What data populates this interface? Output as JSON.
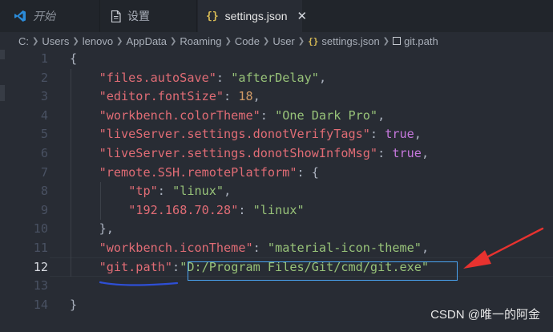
{
  "tabs": [
    {
      "label": "开始",
      "icon": "vscode-logo-icon"
    },
    {
      "label": "设置",
      "icon": "file-icon"
    },
    {
      "label": "settings.json",
      "icon": "json-braces-icon",
      "close": "✕"
    }
  ],
  "breadcrumb": {
    "parts": [
      "C:",
      "Users",
      "lenovo",
      "AppData",
      "Roaming",
      "Code",
      "User"
    ],
    "file": "settings.json",
    "symbol": "git.path"
  },
  "editor": {
    "active_line": "12",
    "line_numbers": [
      "1",
      "2",
      "3",
      "4",
      "5",
      "6",
      "7",
      "8",
      "9",
      "10",
      "11",
      "12",
      "13",
      "14"
    ],
    "lines": [
      {
        "t": "{"
      },
      {
        "key": "\"files.autoSave\"",
        "p1": ": ",
        "val": "\"afterDelay\"",
        "p2": ","
      },
      {
        "key": "\"editor.fontSize\"",
        "p1": ": ",
        "num": "18",
        "p2": ","
      },
      {
        "key": "\"workbench.colorTheme\"",
        "p1": ": ",
        "val": "\"One Dark Pro\"",
        "p2": ","
      },
      {
        "key": "\"liveServer.settings.donotVerifyTags\"",
        "p1": ": ",
        "bool": "true",
        "p2": ","
      },
      {
        "key": "\"liveServer.settings.donotShowInfoMsg\"",
        "p1": ": ",
        "bool": "true",
        "p2": ","
      },
      {
        "key": "\"remote.SSH.remotePlatform\"",
        "p1": ": {"
      },
      {
        "key": "\"tp\"",
        "p1": ": ",
        "val": "\"linux\"",
        "p2": ","
      },
      {
        "key": "\"192.168.70.28\"",
        "p1": ": ",
        "val": "\"linux\""
      },
      {
        "t": "},"
      },
      {
        "key": "\"workbench.iconTheme\"",
        "p1": ": ",
        "val": "\"material-icon-theme\"",
        "p2": ","
      },
      {
        "key": "\"git.path\"",
        "p1": ":",
        "val": "\"D:/Program Files/Git/cmd/git.exe\""
      },
      {
        "t": ""
      },
      {
        "t": "}"
      }
    ]
  },
  "watermark": "CSDN @唯一的阿金",
  "colors": {
    "key": "#e06c75",
    "string": "#98c379",
    "number": "#d19a66",
    "boolean": "#c678dd",
    "annotation": "#e8322f",
    "selection_box": "#4aa3f0"
  }
}
